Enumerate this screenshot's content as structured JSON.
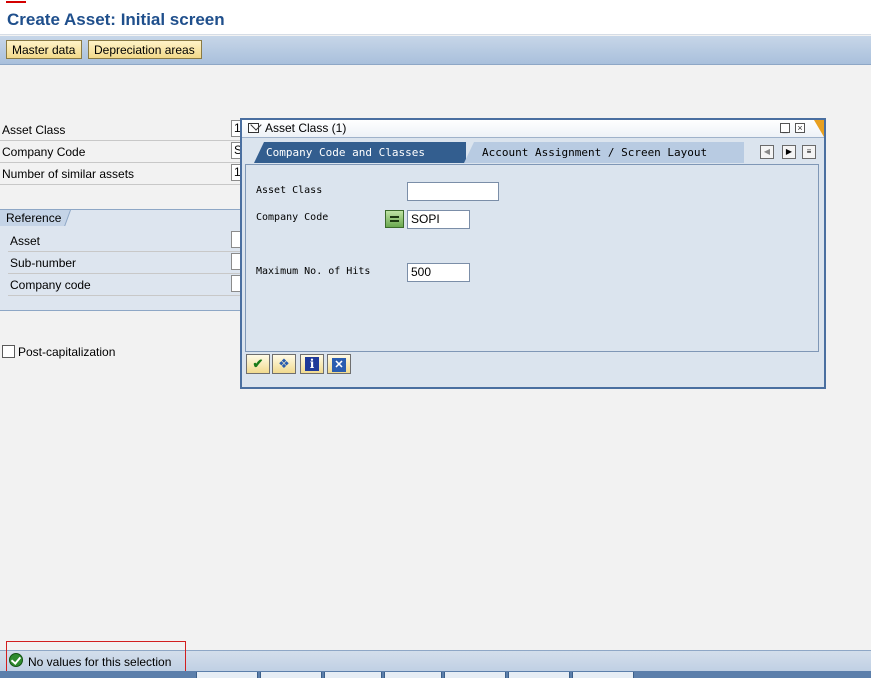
{
  "title": "Create Asset:  Initial screen",
  "toolbar": {
    "master_data": "Master data",
    "depreciation_areas": "Depreciation areas"
  },
  "form": {
    "asset_class": {
      "label": "Asset Class",
      "value": "1"
    },
    "company_code": {
      "label": "Company Code",
      "value": "S"
    },
    "similar_assets": {
      "label": "Number of similar assets",
      "value": "1"
    }
  },
  "reference": {
    "title": "Reference",
    "asset_label": "Asset",
    "subnumber_label": "Sub-number",
    "company_code_label": "Company code"
  },
  "post_capitalization": {
    "label": "Post-capitalization",
    "checked": false
  },
  "dialog": {
    "title": "Asset Class (1)",
    "tabs": [
      {
        "label": "Company Code and Classes",
        "active": true
      },
      {
        "label": "Account Assignment / Screen Layout",
        "active": false
      }
    ],
    "fields": {
      "asset_class": {
        "label": "Asset Class",
        "value": ""
      },
      "company_code": {
        "label": "Company Code",
        "value": "SOPI",
        "operator_icon": "equals-icon"
      },
      "max_hits": {
        "label": "Maximum No. of Hits",
        "value": "500"
      }
    },
    "footer_buttons": [
      "check-icon",
      "search-icon",
      "info-icon",
      "cancel-icon"
    ],
    "footer_glyphs": {
      "ok": "✔",
      "search": "❖",
      "info": "i",
      "cancel": "✕"
    }
  },
  "status": {
    "message": "No values for this selection",
    "type": "success"
  }
}
